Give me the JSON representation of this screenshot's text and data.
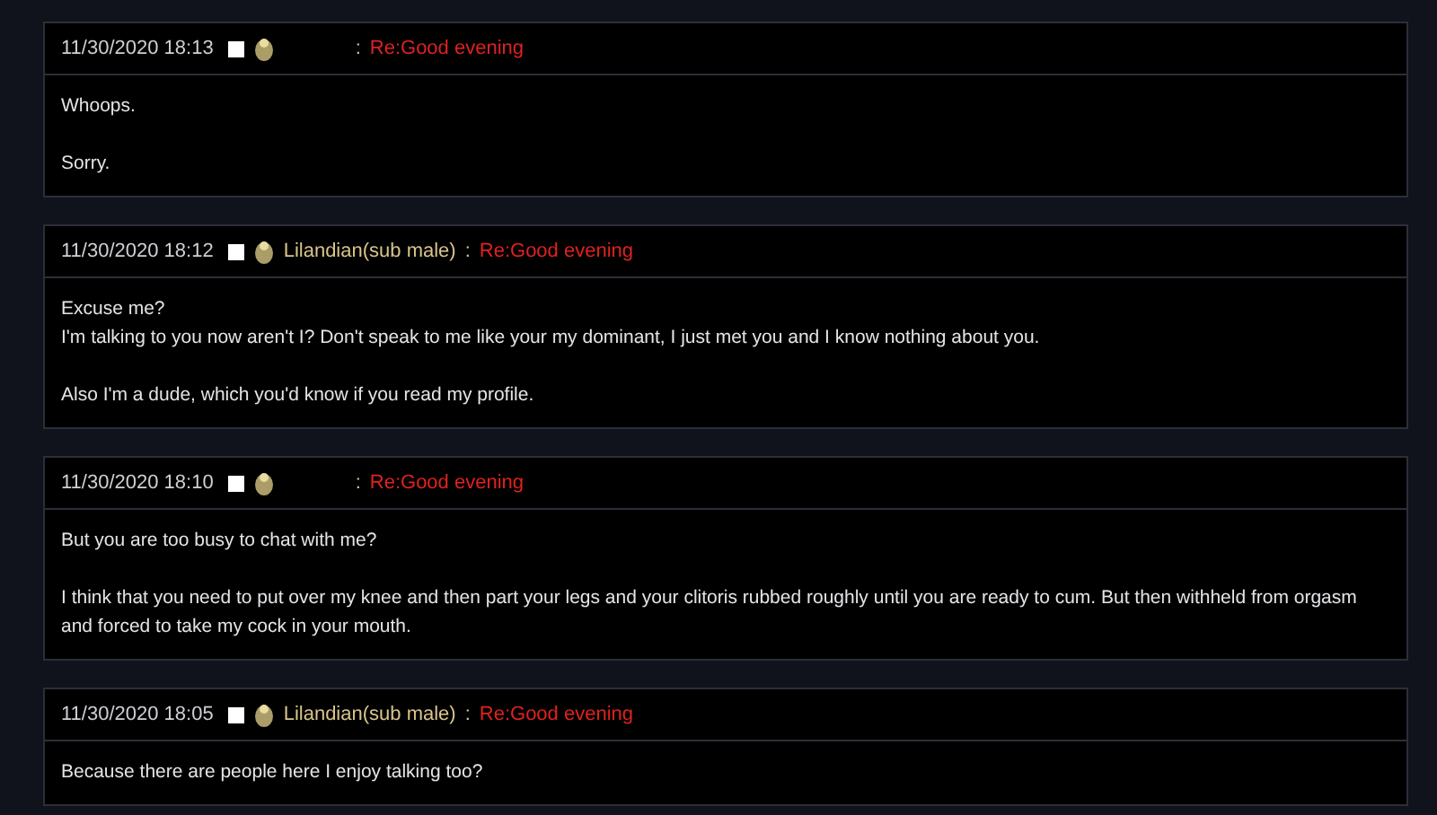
{
  "posts": [
    {
      "timestamp": "11/30/2020 18:13",
      "checked": false,
      "separator": ":",
      "subject": "Re:Good evening",
      "paragraphs": [
        {
          "lines": [
            "Whoops."
          ]
        },
        {
          "lines": [
            "Sorry."
          ]
        }
      ]
    },
    {
      "timestamp": "11/30/2020 18:12",
      "checked": false,
      "author": "Lilandian(sub male)",
      "separator": ":",
      "subject": "Re:Good evening",
      "paragraphs": [
        {
          "lines": [
            "Excuse me?",
            "I'm talking to you now aren't I? Don't speak to me like your my dominant, I just met you and I know nothing about you."
          ]
        },
        {
          "lines": [
            "Also I'm a dude, which you'd know if you read my profile."
          ]
        }
      ]
    },
    {
      "timestamp": "11/30/2020 18:10",
      "checked": false,
      "separator": ":",
      "subject": "Re:Good evening",
      "paragraphs": [
        {
          "lines": [
            "But you are too busy to chat with me?"
          ]
        },
        {
          "lines": [
            "I think that you need to put over my knee and then part your legs and your clitoris rubbed roughly until you are ready to cum. But then withheld from orgasm and forced to take my cock in your mouth."
          ]
        }
      ]
    },
    {
      "timestamp": "11/30/2020 18:05",
      "checked": false,
      "author": "Lilandian(sub male)",
      "separator": ":",
      "subject": "Re:Good evening",
      "paragraphs": [
        {
          "lines": [
            "Because there are people here I enjoy talking too?"
          ]
        }
      ]
    }
  ]
}
